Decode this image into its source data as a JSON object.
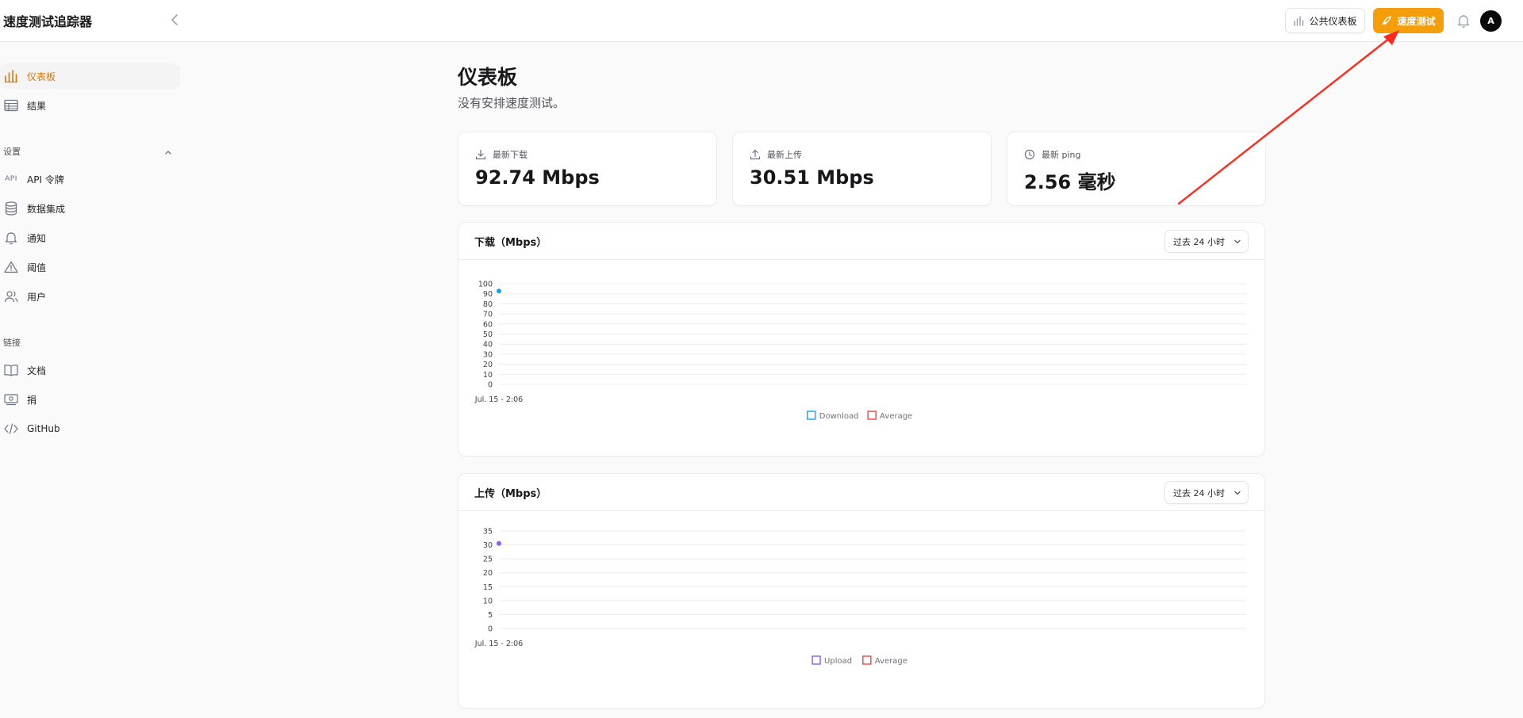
{
  "app": {
    "title": "速度测试追踪器"
  },
  "header": {
    "public_dashboard_label": "公共仪表板",
    "speed_test_label": "速度测试",
    "avatar_initial": "A"
  },
  "sidebar": {
    "items": [
      {
        "label": "仪表板",
        "icon": "bar-chart-icon",
        "active": true
      },
      {
        "label": "结果",
        "icon": "table-icon"
      }
    ],
    "settings_label": "设置",
    "settings_items": [
      {
        "label": "API 令牌",
        "icon": "api-icon",
        "icon_text": "API"
      },
      {
        "label": "数据集成",
        "icon": "database-icon"
      },
      {
        "label": "通知",
        "icon": "bell-icon"
      },
      {
        "label": "阈值",
        "icon": "warning-icon"
      },
      {
        "label": "用户",
        "icon": "users-icon"
      }
    ],
    "links_label": "链接",
    "link_items": [
      {
        "label": "文档",
        "icon": "book-icon"
      },
      {
        "label": "捐",
        "icon": "donate-icon"
      },
      {
        "label": "GitHub",
        "icon": "code-icon"
      }
    ]
  },
  "main": {
    "title": "仪表板",
    "subtitle": "没有安排速度测试。",
    "stats": [
      {
        "label": "最新下载",
        "value": "92.74 Mbps",
        "icon": "download-icon"
      },
      {
        "label": "最新上传",
        "value": "30.51 Mbps",
        "icon": "upload-icon"
      },
      {
        "label": "最新 ping",
        "value": "2.56 毫秒",
        "icon": "clock-icon"
      }
    ],
    "charts": [
      {
        "title": "下载（Mbps）",
        "period": "过去 24 小时"
      },
      {
        "title": "上传（Mbps）",
        "period": "过去 24 小时"
      }
    ]
  },
  "colors": {
    "accent": "#f59e0b",
    "download": "#0ea5e9",
    "upload": "#8b5cf6",
    "average": "#ef4444",
    "annotation_arrow": "#ff2a1a"
  },
  "chart_data": [
    {
      "type": "line",
      "x": [
        "Jul. 15 - 2:06"
      ],
      "series": [
        {
          "name": "Download",
          "values": [
            92.74
          ]
        },
        {
          "name": "Average",
          "values": [
            92.74
          ]
        }
      ],
      "ylim": [
        0,
        100
      ],
      "yticks": [
        0,
        10,
        20,
        30,
        40,
        50,
        60,
        70,
        80,
        90,
        100
      ],
      "grid": true,
      "legend": "bottom-center"
    },
    {
      "type": "line",
      "x": [
        "Jul. 15 - 2:06"
      ],
      "series": [
        {
          "name": "Upload",
          "values": [
            30.51
          ]
        },
        {
          "name": "Average",
          "values": [
            30.51
          ]
        }
      ],
      "ylim": [
        0,
        35
      ],
      "yticks": [
        0,
        5,
        10,
        15,
        20,
        25,
        30,
        35
      ],
      "grid": true,
      "legend": "bottom-center"
    }
  ]
}
